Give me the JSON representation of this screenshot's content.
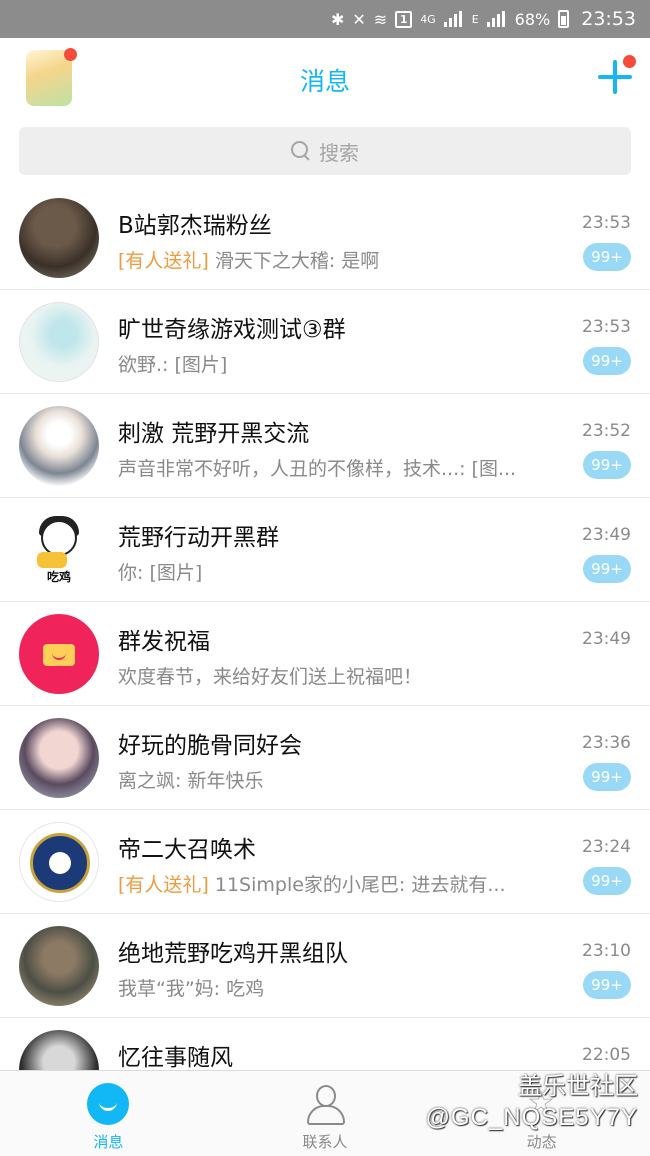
{
  "status_bar": {
    "icons": [
      "bluetooth-icon",
      "mute-icon",
      "wifi-icon",
      "signal-icon",
      "battery-icon"
    ],
    "wifi_label": "1",
    "network_4g": "4G",
    "network_e": "E",
    "battery_percent": "68%",
    "time": "23:53"
  },
  "header": {
    "title": "消息",
    "accent_color": "#12b7f5"
  },
  "search": {
    "placeholder": "搜索"
  },
  "conversations": [
    {
      "name": "B站郭杰瑞粉丝",
      "prefix": "[有人送礼]",
      "message": " 滑天下之大稽: 是啊",
      "time": "23:53",
      "badge": "99+"
    },
    {
      "name": "旷世奇缘游戏测试③群",
      "prefix": "",
      "message": "欲野.: [图片]",
      "time": "23:53",
      "badge": "99+"
    },
    {
      "name": "刺激 荒野开黑交流",
      "prefix": "",
      "message": "声音非常不好听，人丑的不像样，技术...: [图...",
      "time": "23:52",
      "badge": "99+"
    },
    {
      "name": "荒野行动开黑群",
      "prefix": "",
      "message": "你: [图片]",
      "time": "23:49",
      "badge": "99+"
    },
    {
      "name": "群发祝福",
      "prefix": "",
      "message": "欢度春节，来给好友们送上祝福吧！",
      "time": "23:49",
      "badge": ""
    },
    {
      "name": "好玩的脆骨同好会",
      "prefix": "",
      "message": "离之飒: 新年快乐",
      "time": "23:36",
      "badge": "99+"
    },
    {
      "name": "帝二大召唤术",
      "prefix": "[有人送礼]",
      "message": " 11Simple家的小尾巴: 进去就有...",
      "time": "23:24",
      "badge": "99+"
    },
    {
      "name": "绝地荒野吃鸡开黑组队",
      "prefix": "",
      "message": "我草“我”妈: 吃鸡",
      "time": "23:10",
      "badge": "99+"
    },
    {
      "name": "忆往事随风",
      "prefix": "",
      "message": "",
      "time": "22:05",
      "badge": ""
    }
  ],
  "avatar_texts": {
    "meme_caption": "吃鸡"
  },
  "bottom_nav": {
    "tabs": [
      {
        "label": "消息",
        "icon": "message-bubble-icon"
      },
      {
        "label": "联系人",
        "icon": "contacts-icon"
      },
      {
        "label": "动态",
        "icon": "star-icon"
      }
    ]
  },
  "watermark": {
    "line1": "盖乐世社区",
    "line2": "@GC_NQSE5Y7Y"
  }
}
